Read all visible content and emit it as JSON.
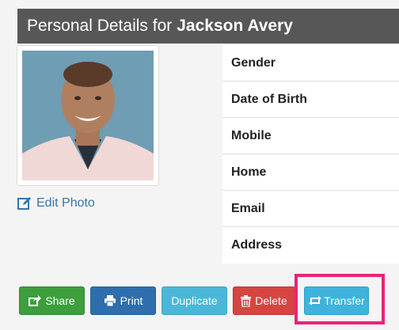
{
  "header": {
    "prefix": "Personal Details for",
    "name": "Jackson Avery"
  },
  "edit_photo": {
    "label": "Edit Photo"
  },
  "details": {
    "fields": [
      "Gender",
      "Date of Birth",
      "Mobile",
      "Home",
      "Email",
      "Address"
    ]
  },
  "buttons": {
    "share": "Share",
    "print": "Print",
    "duplicate": "Duplicate",
    "delete": "Delete",
    "transfer": "Transfer"
  },
  "colors": {
    "header_bg": "#575757",
    "share": "#3c9e3c",
    "print": "#2f6ead",
    "duplicate": "#4bb7d8",
    "delete": "#d64540",
    "transfer": "#3eb3db",
    "highlight": "#e8237a"
  }
}
